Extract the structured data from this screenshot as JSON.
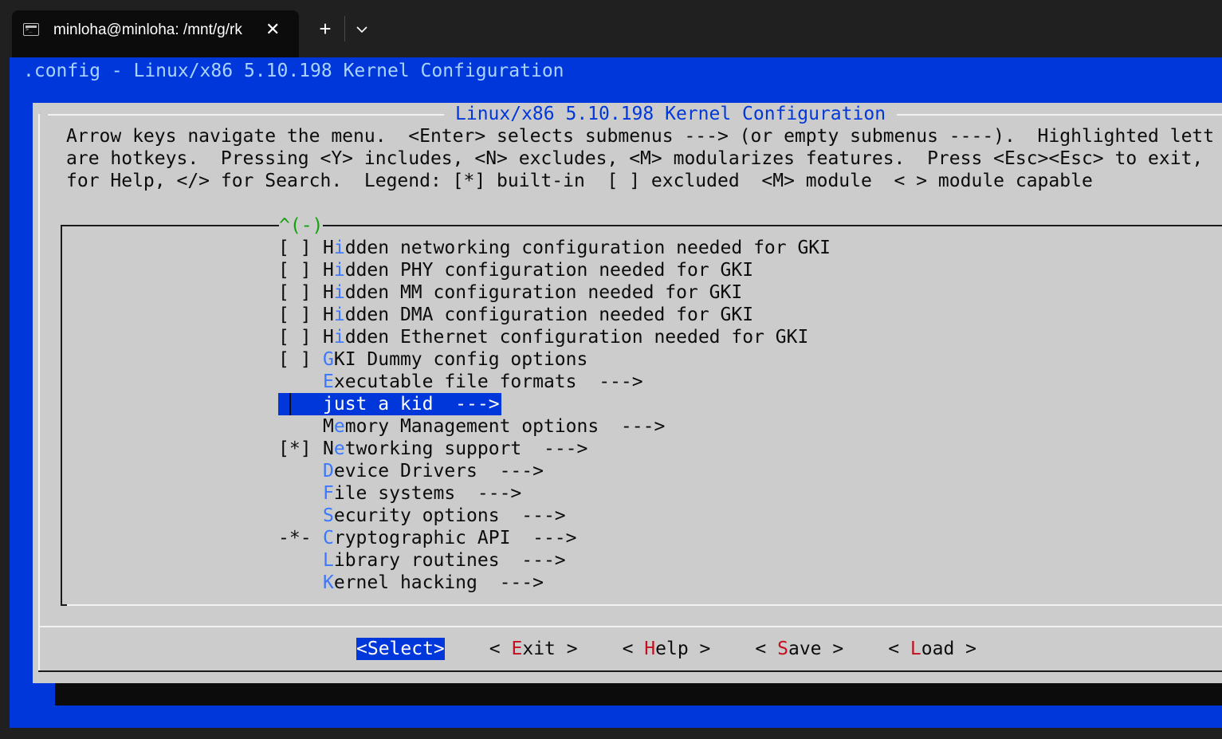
{
  "window": {
    "tab_title": "minloha@minloha: /mnt/g/rk",
    "tab_close": "✕",
    "new_tab": "+",
    "dropdown": "⌵"
  },
  "terminal": {
    "header": ".config - Linux/x86 5.10.198 Kernel Configuration",
    "dialog_title": "Linux/x86 5.10.198 Kernel Configuration",
    "help_lines": [
      "Arrow keys navigate the menu.  <Enter> selects submenus ---> (or empty submenus ----).  Highlighted lett",
      "are hotkeys.  Pressing <Y> includes, <N> excludes, <M> modularizes features.  Press <Esc><Esc> to exit,",
      "for Help, </> for Search.  Legend: [*] built-in  [ ] excluded  <M> module  < > module capable"
    ],
    "scroll_indicator": "^(-)",
    "menu_items": [
      {
        "mark": "[ ]",
        "pre": "H",
        "hk": "i",
        "rest": "dden networking configuration needed for GKI"
      },
      {
        "mark": "[ ]",
        "pre": "H",
        "hk": "i",
        "rest": "dden PHY configuration needed for GKI"
      },
      {
        "mark": "[ ]",
        "pre": "H",
        "hk": "i",
        "rest": "dden MM configuration needed for GKI"
      },
      {
        "mark": "[ ]",
        "pre": "H",
        "hk": "i",
        "rest": "dden DMA configuration needed for GKI"
      },
      {
        "mark": "[ ]",
        "pre": "H",
        "hk": "i",
        "rest": "dden Ethernet configuration needed for GKI"
      },
      {
        "mark": "[ ]",
        "pre": "",
        "hk": "G",
        "rest": "KI Dummy config options"
      },
      {
        "mark": "",
        "pre": "",
        "hk": "E",
        "rest": "xecutable file formats  --->"
      },
      {
        "mark": "",
        "pre": "",
        "hk": "",
        "rest": "just a kid  --->",
        "selected": true
      },
      {
        "mark": "",
        "pre": "M",
        "hk": "e",
        "rest": "mory Management options  --->"
      },
      {
        "mark": "[*]",
        "pre": "N",
        "hk": "e",
        "rest": "tworking support  --->"
      },
      {
        "mark": "",
        "pre": "",
        "hk": "D",
        "rest": "evice Drivers  --->"
      },
      {
        "mark": "",
        "pre": "",
        "hk": "F",
        "rest": "ile systems  --->"
      },
      {
        "mark": "",
        "pre": "",
        "hk": "S",
        "rest": "ecurity options  --->"
      },
      {
        "mark": "-*-",
        "pre": "",
        "hk": "C",
        "rest": "ryptographic API  --->"
      },
      {
        "mark": "",
        "pre": "",
        "hk": "L",
        "rest": "ibrary routines  --->"
      },
      {
        "mark": "",
        "pre": "",
        "hk": "K",
        "rest": "ernel hacking  --->"
      }
    ],
    "buttons": {
      "select": "<Select>",
      "exit": {
        "open": "< ",
        "hk": "E",
        "rest": "xit",
        "close": " >"
      },
      "help": {
        "open": "< ",
        "hk": "H",
        "rest": "elp",
        "close": " >"
      },
      "save": {
        "open": "< ",
        "hk": "S",
        "rest": "ave",
        "close": " >"
      },
      "load": {
        "open": "< ",
        "hk": "L",
        "rest": "oad",
        "close": " >"
      }
    }
  },
  "colors": {
    "terminal_blue": "#0037da",
    "dialog_gray": "#cccccc",
    "hotkey_blue": "#3b78ff",
    "hotkey_red": "#c50f1f",
    "indicator_green": "#13a10e"
  }
}
